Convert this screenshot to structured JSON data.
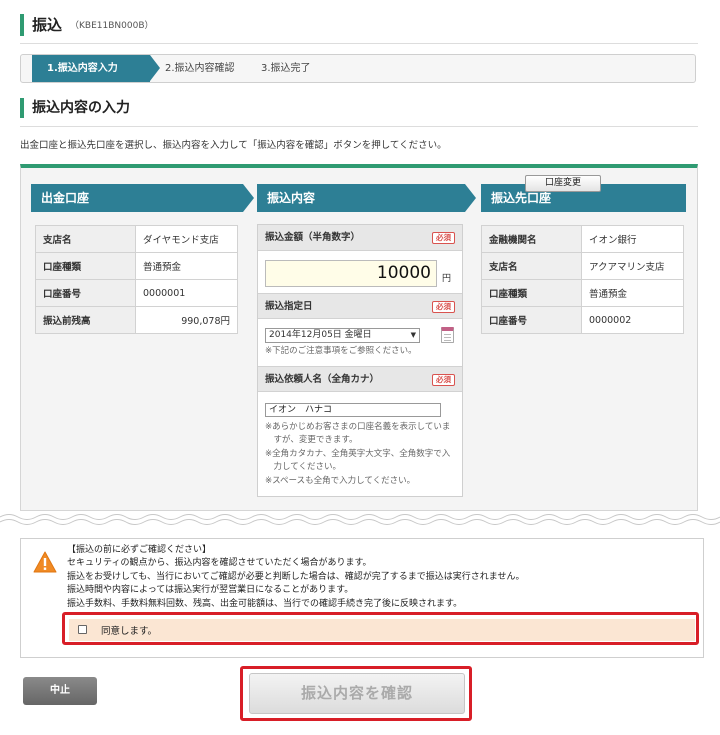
{
  "header": {
    "title": "振込",
    "code": "（KBE11BN000B）"
  },
  "steps": [
    "1.振込内容入力",
    "2.振込内容確認",
    "3.振込完了"
  ],
  "section": {
    "title": "振込内容の入力",
    "instruction": "出金口座と振込先口座を選択し、振込内容を入力して「振込内容を確認」ボタンを押してください。"
  },
  "source": {
    "title": "出金口座",
    "rows": [
      {
        "key": "支店名",
        "value": "ダイヤモンド支店"
      },
      {
        "key": "口座種類",
        "value": "普通預金"
      },
      {
        "key": "口座番号",
        "value": "0000001"
      },
      {
        "key": "振込前残高",
        "value": "990,078円"
      }
    ]
  },
  "transfer": {
    "title": "振込内容",
    "amount_label": "振込金額（半角数字）",
    "amount_value": "10000",
    "currency": "円",
    "date_label": "振込指定日",
    "date_value": "2014年12月05日 金曜日",
    "date_note": "※下記のご注意事項をご参照ください。",
    "name_label": "振込依頼人名（全角カナ）",
    "name_value": "イオン　ハナコ",
    "name_notes": [
      "※あらかじめお客さまの口座名義を表示していま",
      "　すが、変更できます。",
      "※全角カタカナ、全角英字大文字、全角数字で入",
      "　力してください。",
      "※スペースも全角で入力してください。"
    ],
    "required": "必須"
  },
  "dest": {
    "title": "振込先口座",
    "rows": [
      {
        "key": "金融機関名",
        "value": "イオン銀行"
      },
      {
        "key": "支店名",
        "value": "アクアマリン支店"
      },
      {
        "key": "口座種類",
        "value": "普通預金"
      },
      {
        "key": "口座番号",
        "value": "0000002"
      }
    ],
    "change_button": "口座変更"
  },
  "notice": {
    "lines": [
      "【振込の前に必ずご確認ください】",
      "セキュリティの観点から、振込内容を確認させていただく場合があります。",
      "振込をお受けしても、当行においてご確認が必要と判断した場合は、確認が完了するまで振込は実行されません。",
      "振込時間や内容によっては振込実行が翌営業日になることがあります。",
      "振込手数料、手数料無料回数、残高、出金可能額は、当行での確認手続き完了後に反映されます。"
    ],
    "agree_label": "同意します。"
  },
  "buttons": {
    "cancel": "中止",
    "confirm": "振込内容を確認"
  },
  "colors": {
    "accent_green": "#2f9b72",
    "header_blue": "#2d7f95",
    "highlight_red": "#d81e27",
    "agree_bg": "#fbe6d3"
  }
}
